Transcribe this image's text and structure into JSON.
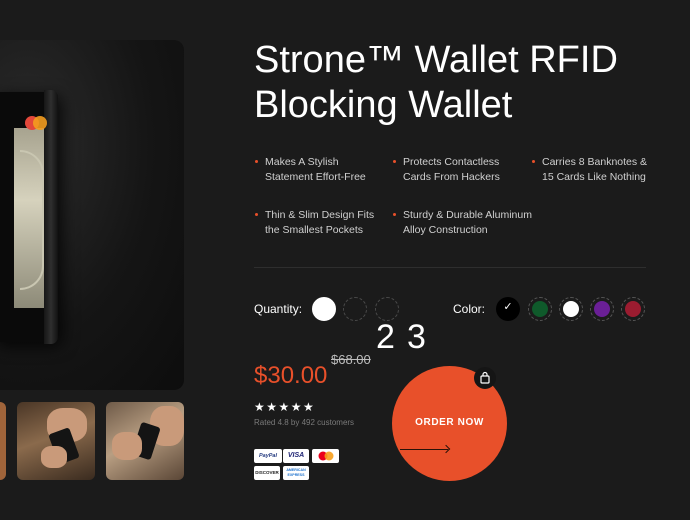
{
  "product": {
    "title_line1": "Strone™ Wallet RFID",
    "title_line2": "Blocking Wallet"
  },
  "features": [
    {
      "line1": "Makes A Stylish",
      "line2": "Statement Effort-Free"
    },
    {
      "line1": "Protects Contactless",
      "line2": "Cards From Hackers"
    },
    {
      "line1": "Carries 8 Banknotes &",
      "line2": "15 Cards Like Nothing"
    },
    {
      "line1": "Thin & Slim Design Fits",
      "line2": "the Smallest Pockets"
    },
    {
      "line1": "Sturdy & Durable Aluminum",
      "line2": "Alloy Construction"
    }
  ],
  "quantity": {
    "label": "Quantity:",
    "options": [
      "",
      "2",
      "3"
    ],
    "selected_index": 0
  },
  "color": {
    "label": "Color:",
    "check_glyph": "✓",
    "swatches": [
      "#000000",
      "#0f5a2b",
      "#ffffff",
      "#6a1f96",
      "#9b1c30"
    ],
    "selected_index": 0
  },
  "pricing": {
    "price": "$30.00",
    "old_price": "$68.00",
    "stars": "★★★★★",
    "rating_text": "Rated 4.8 by 492 customers"
  },
  "payment_methods": [
    "PayPal",
    "VISA",
    "mastercard",
    "DISCOVER",
    "AMERICAN EXPRESS"
  ],
  "cta": {
    "order_label": "ORDER NOW",
    "accent_color": "#e8502a"
  },
  "icons": {
    "bag": "shopping-bag-icon",
    "arrow": "arrow-right-icon"
  }
}
